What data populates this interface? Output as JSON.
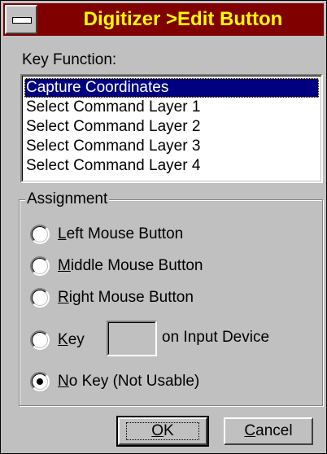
{
  "window": {
    "title": "Digitizer >Edit Button",
    "system_menu_icon": "system-menu-icon"
  },
  "key_function": {
    "label": "Key Function:",
    "items": [
      "Capture Coordinates",
      "Select Command Layer 1",
      "Select Command Layer 2",
      "Select Command Layer 3",
      "Select Command Layer 4"
    ],
    "selected": "Capture Coordinates"
  },
  "assignment": {
    "title": "Assignment",
    "options": {
      "left_mouse": {
        "mnemonic": "L",
        "rest": "eft Mouse Button"
      },
      "middle_mouse": {
        "mnemonic": "M",
        "rest": "iddle Mouse Button"
      },
      "right_mouse": {
        "mnemonic": "R",
        "rest": "ight Mouse Button"
      },
      "key": {
        "mnemonic": "K",
        "rest": "ey"
      },
      "no_key": {
        "mnemonic": "N",
        "rest": "o Key (Not Usable)"
      }
    },
    "selected_option": "no_key",
    "key_value": "",
    "input_device_text": "on Input Device"
  },
  "buttons": {
    "ok": {
      "mnemonic": "O",
      "rest": "K"
    },
    "cancel": {
      "mnemonic": "C",
      "rest": "ancel"
    }
  },
  "colors": {
    "title_bar": "#800000",
    "title_text": "#ffff00",
    "selection": "#000080",
    "face": "#c0c0c0"
  }
}
